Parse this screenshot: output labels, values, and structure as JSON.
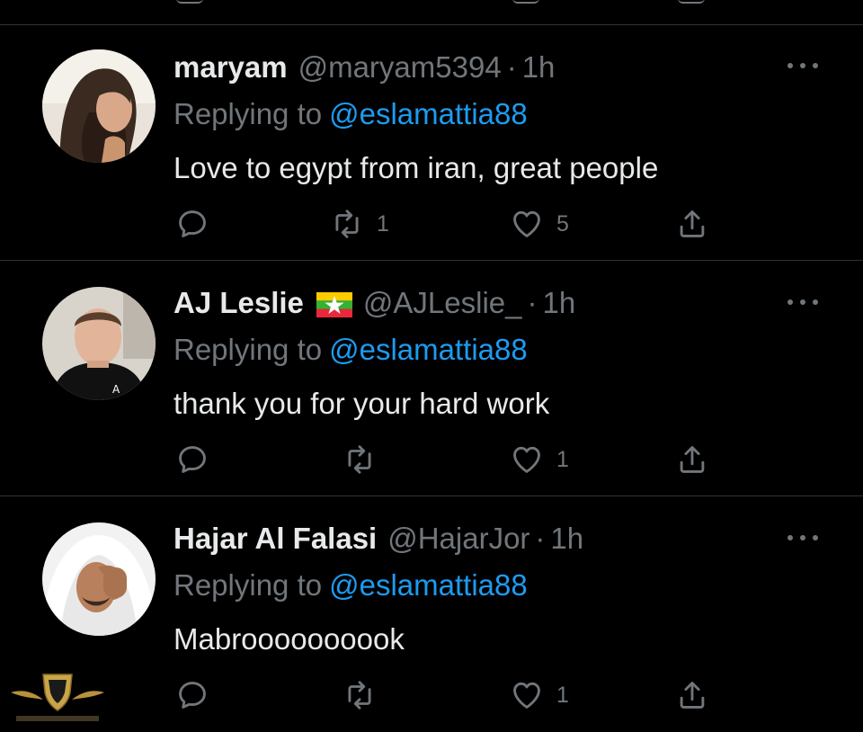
{
  "tweets": [
    {
      "name": "maryam",
      "handle": "@maryam5394",
      "dot": "·",
      "time": "1h",
      "replying_prefix": "Replying to",
      "replying_to": "@eslamattia88",
      "text": "Love to egypt from iran, great people",
      "replies": "",
      "retweets": "1",
      "likes": "5",
      "has_flag": false
    },
    {
      "name": "AJ Leslie",
      "handle": "@AJLeslie_",
      "dot": "·",
      "time": "1h",
      "replying_prefix": "Replying to",
      "replying_to": "@eslamattia88",
      "text": "thank you for your hard work",
      "replies": "",
      "retweets": "",
      "likes": "1",
      "has_flag": true,
      "flag_icon": "myanmar-flag-icon"
    },
    {
      "name": "Hajar Al Falasi",
      "handle": "@HajarJor",
      "dot": "·",
      "time": "1h",
      "replying_prefix": "Replying to",
      "replying_to": "@eslamattia88",
      "text": "Mabroooooooook",
      "replies": "",
      "retweets": "",
      "likes": "1",
      "has_flag": false
    }
  ],
  "icons": {
    "reply": "reply-icon",
    "retweet": "retweet-icon",
    "like": "heart-icon",
    "share": "share-icon",
    "more": "more-options-icon"
  },
  "colors": {
    "background": "#000000",
    "text": "#e7e9ea",
    "secondary": "#71767b",
    "link": "#1d9bf0",
    "divider": "#2f3336"
  }
}
